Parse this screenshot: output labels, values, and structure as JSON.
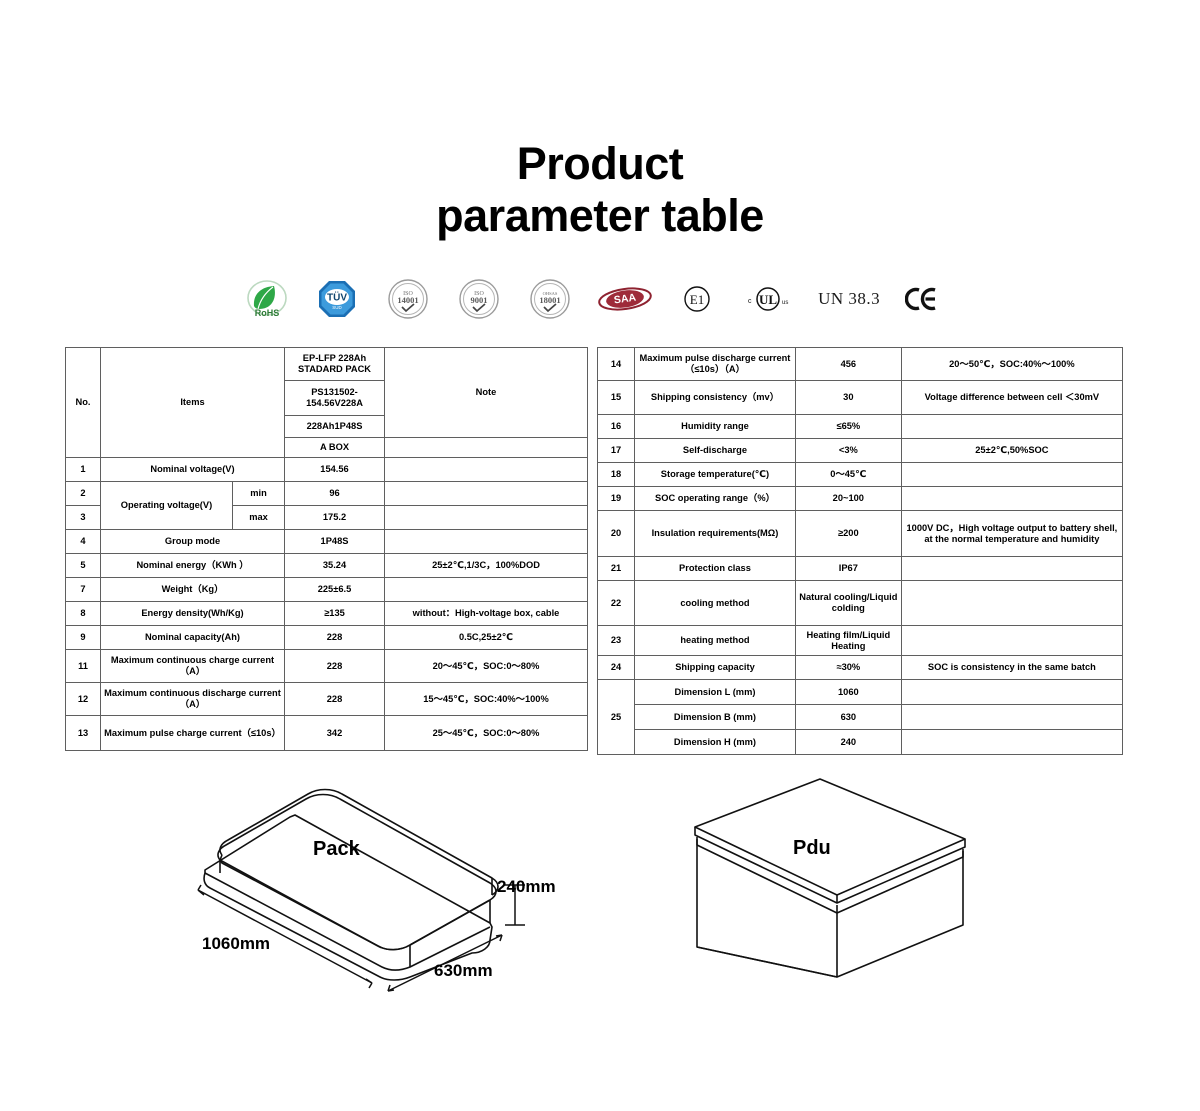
{
  "title": {
    "line1": "Product",
    "line2": "parameter table"
  },
  "certifications": [
    {
      "name": "rohs-badge",
      "label": "RoHS"
    },
    {
      "name": "tuv-badge",
      "label": "TUV"
    },
    {
      "name": "iso14001-badge",
      "label": "ISO 14001"
    },
    {
      "name": "iso9001-badge",
      "label": "ISO 9001"
    },
    {
      "name": "ohsas18001-badge",
      "label": "OHSAS 18001"
    },
    {
      "name": "saa-badge",
      "label": "SAA"
    },
    {
      "name": "e1-badge",
      "label": "E1"
    },
    {
      "name": "ul-badge",
      "label": "cULus"
    },
    {
      "name": "un383-badge",
      "label": "UN 38.3"
    },
    {
      "name": "ce-badge",
      "label": "CE"
    }
  ],
  "table_left": {
    "header": {
      "no": "No.",
      "items": "Items",
      "note": "Note",
      "model_lines": [
        "EP-LFP 228Ah STADARD PACK",
        "PS131502-154.56V228A",
        "228Ah1P48S",
        "A BOX"
      ]
    },
    "rows": [
      {
        "no": "1",
        "item": "Nominal voltage(V)",
        "sub": "",
        "value": "154.56",
        "note": ""
      },
      {
        "no": "2",
        "item": "Operating voltage(V)",
        "sub": "min",
        "value": "96",
        "note": ""
      },
      {
        "no": "3",
        "item": "",
        "sub": "max",
        "value": "175.2",
        "note": ""
      },
      {
        "no": "4",
        "item": "Group mode",
        "sub": "",
        "value": "1P48S",
        "note": ""
      },
      {
        "no": "5",
        "item": "Nominal energy（KWh ）",
        "sub": "",
        "value": "35.24",
        "note": "25±2℃,1/3C，100%DOD"
      },
      {
        "no": "7",
        "item": "Weight（Kg）",
        "sub": "",
        "value": "225±6.5",
        "note": ""
      },
      {
        "no": "8",
        "item": "Energy density(Wh/Kg)",
        "sub": "",
        "value": "≥135",
        "note": "without：High-voltage box, cable"
      },
      {
        "no": "9",
        "item": "Nominal capacity(Ah)",
        "sub": "",
        "value": "228",
        "note": "0.5C,25±2℃"
      },
      {
        "no": "11",
        "item": "Maximum continuous charge current（A）",
        "sub": "",
        "value": "228",
        "note": "20～45℃，SOC:0～80%"
      },
      {
        "no": "12",
        "item": "Maximum continuous discharge current（A）",
        "sub": "",
        "value": "228",
        "note": "15～45℃，SOC:40%～100%"
      },
      {
        "no": "13",
        "item": "Maximum  pulse charge current（≤10s）",
        "sub": "",
        "value": "342",
        "note": "25～45℃，SOC:0～80%"
      }
    ]
  },
  "table_right": {
    "rows": [
      {
        "no": "14",
        "item": "Maximum  pulse discharge current（≤10s）（A）",
        "value": "456",
        "note": "20～50℃，SOC:40%～100%"
      },
      {
        "no": "15",
        "item": "Shipping consistency（mv）",
        "value": "30",
        "note": "Voltage difference between cell ＜30mV"
      },
      {
        "no": "16",
        "item": "Humidity range",
        "value": "≤65%",
        "note": ""
      },
      {
        "no": "17",
        "item": "Self-discharge",
        "value": "<3%",
        "note": "25±2℃,50%SOC"
      },
      {
        "no": "18",
        "item": "Storage temperature(℃)",
        "value": "0～45℃",
        "note": ""
      },
      {
        "no": "19",
        "item": "SOC operating range（%）",
        "value": "20~100",
        "note": ""
      },
      {
        "no": "20",
        "item": "Insulation requirements(MΩ)",
        "value": "≥200",
        "note": "1000V DC，High voltage output to battery  shell, at the normal temperature and humidity"
      },
      {
        "no": "21",
        "item": "Protection class",
        "value": "IP67",
        "note": ""
      },
      {
        "no": "22",
        "item": "cooling method",
        "value": "Natural cooling/Liquid colding",
        "note": ""
      },
      {
        "no": "23",
        "item": "heating method",
        "value": "Heating film/Liquid Heating",
        "note": ""
      },
      {
        "no": "24",
        "item": "Shipping capacity",
        "value": "≈30%",
        "note": "SOC is consistency in the same batch"
      },
      {
        "no": "25",
        "item": "Dimension L (mm)",
        "value": "1060",
        "note": ""
      },
      {
        "no": "",
        "item": "Dimension B (mm)",
        "value": "630",
        "note": ""
      },
      {
        "no": "",
        "item": "Dimension H (mm)",
        "value": "240",
        "note": ""
      }
    ]
  },
  "drawings": {
    "pack": {
      "label": "Pack",
      "length": "1060mm",
      "width": "630mm",
      "height": "240mm"
    },
    "pdu": {
      "label": "Pdu"
    }
  }
}
